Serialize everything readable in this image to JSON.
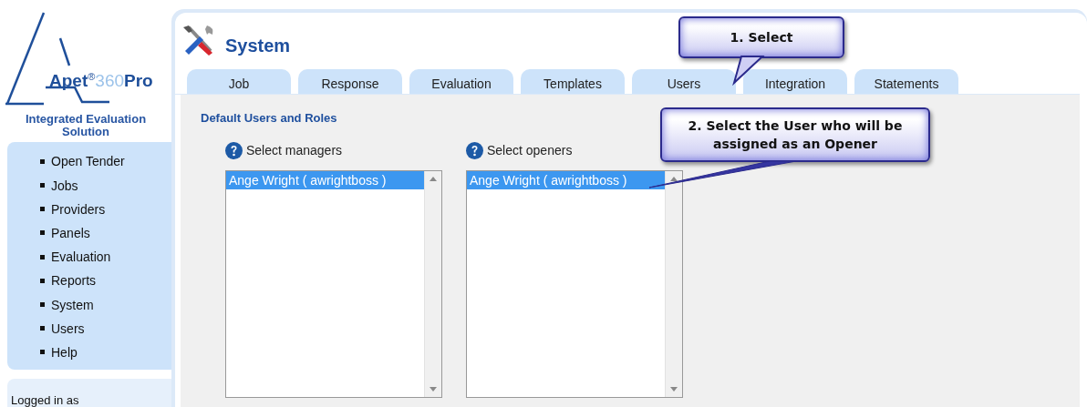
{
  "logo": {
    "name": "Apet",
    "mark": "®",
    "number": "360",
    "suffix": "Pro",
    "tagline": "Integrated Evaluation Solution"
  },
  "sidebar": {
    "items": [
      {
        "label": "Open Tender"
      },
      {
        "label": "Jobs"
      },
      {
        "label": "Providers"
      },
      {
        "label": "Panels"
      },
      {
        "label": "Evaluation"
      },
      {
        "label": "Reports"
      },
      {
        "label": "System"
      },
      {
        "label": "Users"
      },
      {
        "label": "Help"
      }
    ],
    "login": "Logged in as"
  },
  "page": {
    "title": "System"
  },
  "tabs": [
    {
      "label": "Job",
      "selected": false
    },
    {
      "label": "Response",
      "selected": false
    },
    {
      "label": "Evaluation",
      "selected": false
    },
    {
      "label": "Templates",
      "selected": false
    },
    {
      "label": "Users",
      "selected": false
    },
    {
      "label": "Integration",
      "selected": false
    },
    {
      "label": "Statements",
      "selected": false
    }
  ],
  "section": {
    "title": "Default Users and Roles",
    "lists": [
      {
        "label": "Select managers",
        "items": [
          {
            "text": "Ange Wright ( awrightboss )",
            "selected": true
          }
        ]
      },
      {
        "label": "Select openers",
        "items": [
          {
            "text": "Ange Wright ( awrightboss )",
            "selected": true
          }
        ]
      }
    ]
  },
  "callouts": [
    {
      "text": "1. Select"
    },
    {
      "text": "2. Select the User who will be assigned as an Opener"
    }
  ]
}
